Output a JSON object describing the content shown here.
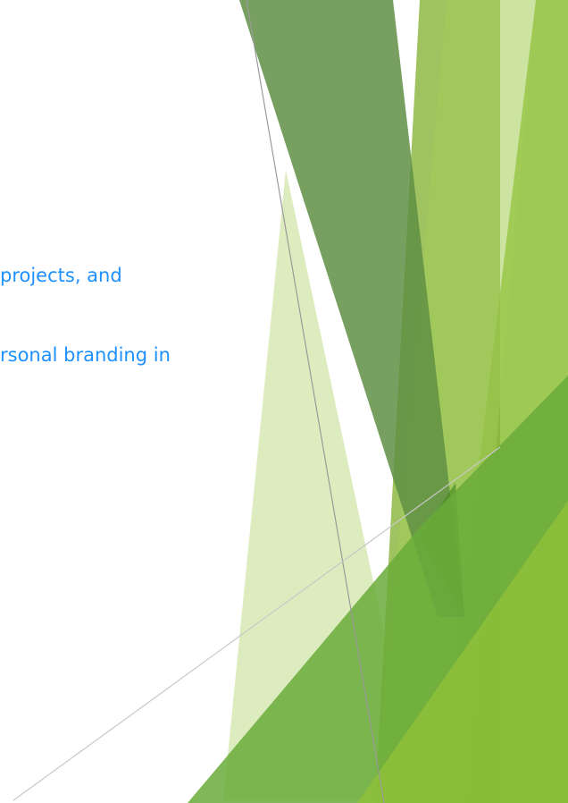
{
  "slide": {
    "body_lines": [
      "projects, and",
      "rsonal branding in"
    ]
  },
  "theme": {
    "text_color": "#1e90ff",
    "background": "#ffffff",
    "accent_colors": [
      "#6a9a4c",
      "#88b43a",
      "#8dc03a",
      "#a3cc55",
      "#c6df95",
      "#4a8a24"
    ]
  }
}
